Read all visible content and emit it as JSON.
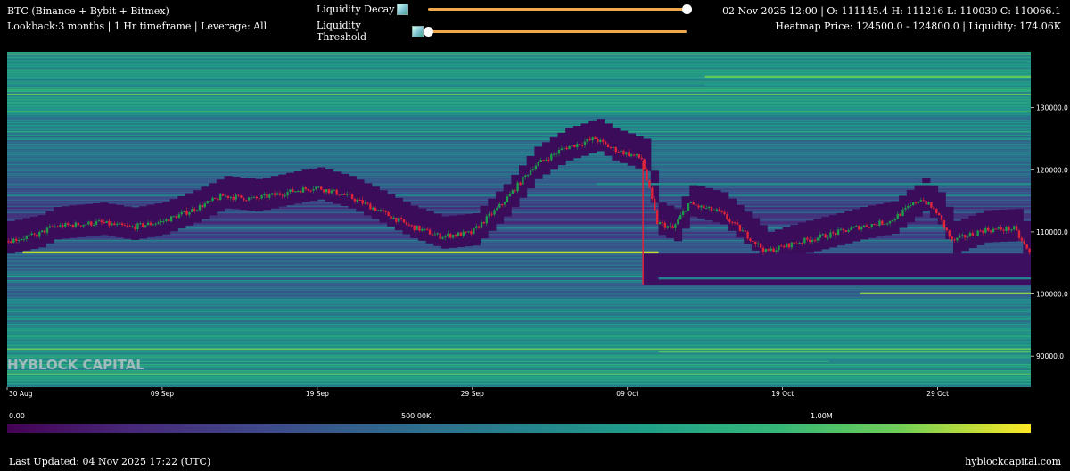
{
  "header": {
    "title": "BTC (Binance + Bybit + Bitmex)",
    "subtitle": "Lookback:3 months | 1 Hr timeframe | Leverage: All",
    "ohlc": "02 Nov 2025 12:00 | O: 111145.4 H: 111216 L: 110030 C: 110066.1",
    "heatmap_info": "Heatmap Price: 124500.0 - 124800.0 | Liquidity: 174.06K"
  },
  "controls": {
    "decay_label": "Liquidity Decay",
    "threshold_label": "Liquidity Threshold",
    "decay_value": 1.0,
    "threshold_value": 0.0,
    "accent": "#f0a94a"
  },
  "watermark": "HYBLOCK CAPITAL",
  "colorbar": {
    "labels": [
      "0.00",
      "500.00K",
      "1.00M"
    ],
    "scale": "viridis"
  },
  "footer": {
    "updated": "Last Updated: 04 Nov 2025 17:22 (UTC)",
    "site": "hyblockcapital.com"
  },
  "chart_data": {
    "type": "heatmap",
    "overlay": "candlestick",
    "x_start": "2025-08-30",
    "x_end": "2025-11-04",
    "x_ticks": [
      "30 Aug",
      "09 Sep",
      "19 Sep",
      "29 Sep",
      "09 Oct",
      "19 Oct",
      "29 Oct"
    ],
    "y_ticks": [
      130000,
      120000,
      110000,
      100000,
      90000
    ],
    "y_tick_labels": [
      "130000.0",
      "120000.0",
      "110000.0",
      "100000.0",
      "90000.0"
    ],
    "ylim": [
      85000,
      139000
    ],
    "price_path": [
      {
        "date": "2025-08-30",
        "price": 108500
      },
      {
        "date": "2025-09-01",
        "price": 109500
      },
      {
        "date": "2025-09-02",
        "price": 110800
      },
      {
        "date": "2025-09-05",
        "price": 111500
      },
      {
        "date": "2025-09-07",
        "price": 110700
      },
      {
        "date": "2025-09-09",
        "price": 111600
      },
      {
        "date": "2025-09-11",
        "price": 113500
      },
      {
        "date": "2025-09-13",
        "price": 115800
      },
      {
        "date": "2025-09-15",
        "price": 115300
      },
      {
        "date": "2025-09-18",
        "price": 116800
      },
      {
        "date": "2025-09-19",
        "price": 117200
      },
      {
        "date": "2025-09-21",
        "price": 115800
      },
      {
        "date": "2025-09-23",
        "price": 113500
      },
      {
        "date": "2025-09-25",
        "price": 111000
      },
      {
        "date": "2025-09-27",
        "price": 109300
      },
      {
        "date": "2025-09-29",
        "price": 109800
      },
      {
        "date": "2025-10-01",
        "price": 114500
      },
      {
        "date": "2025-10-03",
        "price": 120500
      },
      {
        "date": "2025-10-05",
        "price": 123500
      },
      {
        "date": "2025-10-07",
        "price": 125000
      },
      {
        "date": "2025-10-08",
        "price": 123500
      },
      {
        "date": "2025-10-10",
        "price": 121800
      },
      {
        "date": "2025-10-11",
        "price": 111500
      },
      {
        "date": "2025-10-12",
        "price": 110500
      },
      {
        "date": "2025-10-13",
        "price": 114500
      },
      {
        "date": "2025-10-15",
        "price": 113200
      },
      {
        "date": "2025-10-17",
        "price": 109000
      },
      {
        "date": "2025-10-18",
        "price": 106800
      },
      {
        "date": "2025-10-20",
        "price": 108300
      },
      {
        "date": "2025-10-22",
        "price": 109500
      },
      {
        "date": "2025-10-24",
        "price": 110800
      },
      {
        "date": "2025-10-26",
        "price": 111700
      },
      {
        "date": "2025-10-28",
        "price": 115400
      },
      {
        "date": "2025-10-29",
        "price": 113200
      },
      {
        "date": "2025-10-30",
        "price": 108500
      },
      {
        "date": "2025-11-01",
        "price": 110300
      },
      {
        "date": "2025-11-03",
        "price": 110500
      },
      {
        "date": "2025-11-04",
        "price": 106500
      }
    ],
    "wick_low": {
      "date": "2025-10-10",
      "price": 101500
    },
    "bright_levels": [
      {
        "price": 135000,
        "from": "2025-10-14",
        "intensity": 0.85
      },
      {
        "price": 133700,
        "from": "2025-10-14",
        "intensity": 0.6
      },
      {
        "price": 117700,
        "from": "2025-10-07",
        "intensity": 0.55
      },
      {
        "price": 106700,
        "from": "2025-08-31",
        "to": "2025-10-11",
        "intensity": 0.95
      },
      {
        "price": 100100,
        "from": "2025-10-24",
        "intensity": 0.9
      },
      {
        "price": 102500,
        "from": "2025-10-11",
        "intensity": 0.5
      },
      {
        "price": 90700,
        "from": "2025-10-11",
        "intensity": 0.8
      },
      {
        "price": 89200,
        "from": "2025-10-22",
        "intensity": 0.5
      }
    ],
    "title": "",
    "xlabel": "",
    "ylabel": ""
  }
}
